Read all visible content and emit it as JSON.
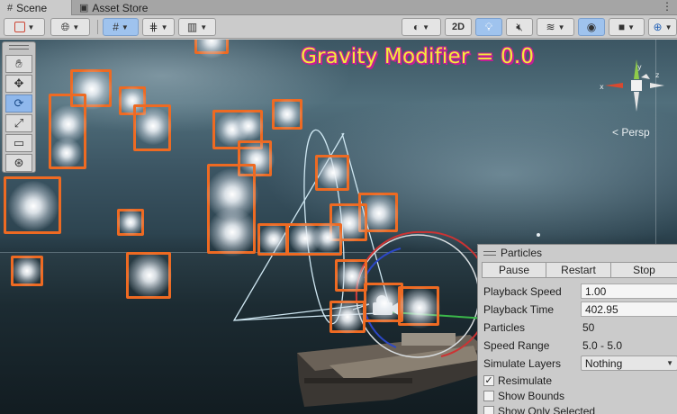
{
  "tabs": {
    "scene": "Scene",
    "asset_store": "Asset Store",
    "menu_glyph": "⋮"
  },
  "toolbar": {
    "mode_2d": "2D",
    "icons": [
      "draw-mode-icon",
      "globe-icon",
      "grid-snap-icon",
      "snap-increment-icon",
      "ruler-icon",
      "shading-icon",
      "light-bulb-icon",
      "audio-mute-icon",
      "layers-icon",
      "visibility-icon",
      "camera-icon",
      "gizmos-icon"
    ]
  },
  "scene": {
    "overlay_text": "Gravity Modifier = 0.0",
    "projection_label": "< Persp",
    "particle_outline_color": "#ee6a22",
    "overlay_text_color": "#f3ec3a"
  },
  "tools": [
    "hand-tool-icon",
    "move-tool-icon",
    "rotate-tool-icon",
    "scale-tool-icon",
    "rect-tool-icon",
    "transform-tool-icon"
  ],
  "particles_panel": {
    "title": "Particles",
    "buttons": {
      "pause": "Pause",
      "restart": "Restart",
      "stop": "Stop"
    },
    "playback_speed": {
      "label": "Playback Speed",
      "value": "1.00"
    },
    "playback_time": {
      "label": "Playback Time",
      "value": "402.95"
    },
    "particles": {
      "label": "Particles",
      "value": "50"
    },
    "speed_range": {
      "label": "Speed Range",
      "value": "5.0 - 5.0"
    },
    "simulate_layers": {
      "label": "Simulate Layers",
      "value": "Nothing"
    },
    "resimulate": {
      "label": "Resimulate",
      "checked": true
    },
    "show_bounds": {
      "label": "Show Bounds",
      "checked": false
    },
    "show_only_selected": {
      "label": "Show Only Selected",
      "checked": false
    }
  }
}
